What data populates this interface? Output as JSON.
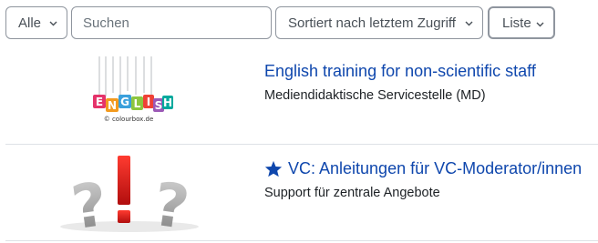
{
  "toolbar": {
    "filter_label": "Alle",
    "search_placeholder": "Suchen",
    "sort_label": "Sortiert nach letztem Zugriff",
    "view_label": "Liste"
  },
  "courses": [
    {
      "title": "English training for non-scientific staff",
      "category": "Mediendidaktische Servicestelle (MD)",
      "starred": false,
      "image_alt": "English letter cubes",
      "image_credit": "© colourbox.de",
      "image_letters": [
        "E",
        "N",
        "G",
        "L",
        "I",
        "S",
        "H"
      ]
    },
    {
      "title": "VC: Anleitungen für VC-Moderator/innen",
      "category": "Support für zentrale Angebote",
      "starred": true,
      "image_alt": "question marks and exclamation mark"
    }
  ],
  "colors": {
    "link": "#0f47ad",
    "star": "#0f47ad",
    "border": "#8f959e",
    "separator": "#dee2e6"
  }
}
